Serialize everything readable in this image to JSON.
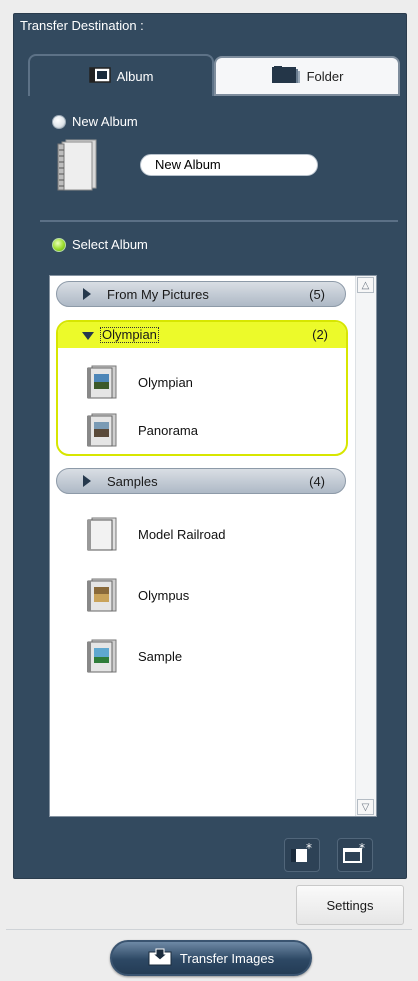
{
  "panel": {
    "title": "Transfer Destination :"
  },
  "tabs": [
    {
      "label": "Album",
      "icon": "album-icon",
      "active": true
    },
    {
      "label": "Folder",
      "icon": "folder-icon",
      "active": false
    }
  ],
  "new_album": {
    "label": "New Album",
    "selected": false,
    "name_value": "New Album"
  },
  "select_album": {
    "label": "Select Album",
    "selected": true
  },
  "groups": [
    {
      "name": "From My Pictures",
      "count": "(5)",
      "expanded": false
    },
    {
      "name": "Olympian",
      "count": "(2)",
      "expanded": true,
      "items": [
        "Olympian",
        "Panorama"
      ]
    },
    {
      "name": "Samples",
      "count": "(4)",
      "expanded": false
    }
  ],
  "loose_items": [
    "Model Railroad",
    "Olympus",
    "Sample"
  ],
  "buttons": {
    "new_album_icon": "new-album-icon",
    "new_folder_icon": "new-folder-icon",
    "settings_label": "Settings",
    "transfer_label": "Transfer Images"
  },
  "colors": {
    "panel_bg": "#334a5f",
    "highlight_border": "#d7e600",
    "highlight_header": "#ecfa2a",
    "radio_selected": "#9bdc2e"
  }
}
